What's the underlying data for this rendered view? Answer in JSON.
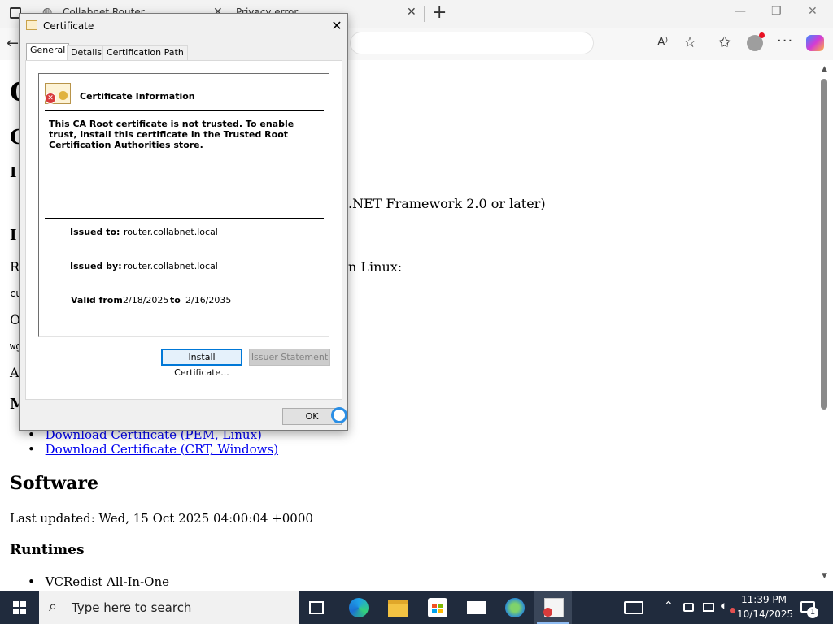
{
  "browser": {
    "tabs": [
      {
        "label": "Collabnet Router"
      },
      {
        "label": "Privacy error"
      }
    ],
    "new_tab_glyph": "+",
    "toolbar_icons": [
      "back-icon",
      "read-aloud-icon",
      "favorite-icon",
      "favorites-icon",
      "profile-icon",
      "more-icon",
      "copilot-icon"
    ],
    "window_controls": {
      "minimize": "—",
      "maximize": "❐",
      "close": "✕"
    }
  },
  "webpage": {
    "h1_partial": "C",
    "h2_partial": "C",
    "h3_partial_1": "I",
    "netfx_text": ".NET Framework 2.0 or later)",
    "h3_partial_2": "I",
    "para_partial": "R",
    "linux_text": "n Linux:",
    "code_partial_1": "cu",
    "para_partial_2": "O",
    "code_partial_2": "wg",
    "para_partial_3": "A",
    "h3_partial_3": "M",
    "links": [
      {
        "label": "Download Certificate (PEM, Linux)"
      },
      {
        "label": "Download Certificate (CRT, Windows)"
      }
    ],
    "software_heading": "Software",
    "last_updated": "Last updated: Wed, 15 Oct 2025 04:00:04 +0000",
    "runtimes_heading": "Runtimes",
    "runtime_items": [
      "VCRedist All-In-One"
    ]
  },
  "dialog": {
    "title": "Certificate",
    "close_glyph": "✕",
    "tabs": [
      {
        "label": "General",
        "active": true
      },
      {
        "label": "Details",
        "active": false
      },
      {
        "label": "Certification Path",
        "active": false
      }
    ],
    "info_title": "Certificate Information",
    "warning": "This CA Root certificate is not trusted. To enable trust, install this certificate in the Trusted Root Certification Authorities store.",
    "issued_to_label": "Issued to:",
    "issued_to": "router.collabnet.local",
    "issued_by_label": "Issued by:",
    "issued_by": "router.collabnet.local",
    "valid_from_label": "Valid from",
    "valid_from": "2/18/2025",
    "valid_to_label": "to",
    "valid_to": "2/16/2035",
    "install_button": "Install Certificate...",
    "issuer_button": "Issuer Statement",
    "ok_button": "OK"
  },
  "taskbar": {
    "search_placeholder": "Type here to search",
    "time": "11:39 PM",
    "date": "10/14/2025",
    "notification_count": "1",
    "app_icons": [
      "task-view-icon",
      "edge-icon",
      "file-explorer-icon",
      "store-icon",
      "mail-icon",
      "network-globe-icon",
      "certificate-app-icon"
    ]
  },
  "colors": {
    "taskbar_bg": "#202b3d",
    "accent": "#0078d7",
    "link": "#0000ee"
  }
}
